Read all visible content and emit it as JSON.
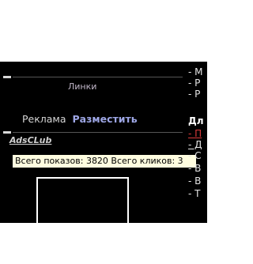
{
  "panel": {
    "title": "Линки",
    "ad_label": "Реклама",
    "place_link": "Разместить",
    "club_link": "AdsCLub",
    "tooltip": "Всего показов: 3820 Всего кликов: 3"
  },
  "right_column": {
    "items": [
      "- M",
      "- Р",
      "- Р",
      "Дл",
      "- П",
      "- Д",
      "- С",
      "- В",
      "- В",
      "- Т"
    ]
  },
  "colors": {
    "background": "#000000",
    "title": "#c0b6c8",
    "link": "#9ea7e6",
    "tooltip_bg": "#fffde0",
    "accent_red": "#d83a3a"
  }
}
